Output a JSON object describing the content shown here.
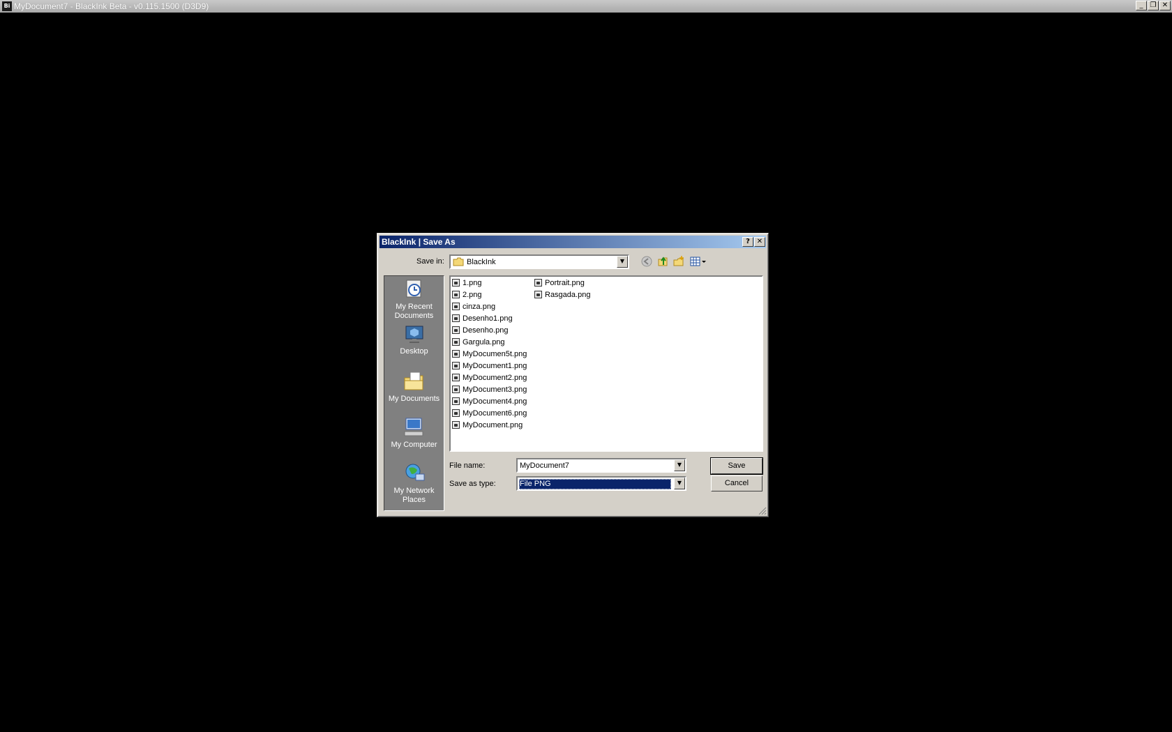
{
  "app": {
    "icon_text": "Bi",
    "title": "MyDocument7 - BlackInk Beta - v0.115.1500 (D3D9)",
    "minimize": "_",
    "restore": "❐",
    "close": "✕"
  },
  "dialog": {
    "title": "BlackInk | Save As",
    "help": "?",
    "close": "✕",
    "save_in_label": "Save in:",
    "save_in_value": "BlackInk",
    "places": [
      {
        "label": "My Recent Documents",
        "icon": "recent-documents-icon"
      },
      {
        "label": "Desktop",
        "icon": "desktop-icon"
      },
      {
        "label": "My Documents",
        "icon": "my-documents-icon"
      },
      {
        "label": "My Computer",
        "icon": "my-computer-icon"
      },
      {
        "label": "My Network Places",
        "icon": "network-places-icon"
      }
    ],
    "files_col1": [
      "1.png",
      "2.png",
      "cinza.png",
      "Desenho1.png",
      "Desenho.png",
      "Gargula.png",
      "MyDocumen5t.png",
      "MyDocument1.png",
      "MyDocument2.png",
      "MyDocument3.png",
      "MyDocument4.png",
      "MyDocument6.png",
      "MyDocument.png"
    ],
    "files_col2": [
      "Portrait.png",
      "Rasgada.png"
    ],
    "file_name_label": "File name:",
    "file_name_value": "MyDocument7",
    "save_type_label": "Save as type:",
    "save_type_value": "File PNG",
    "save_button": "Save",
    "cancel_button": "Cancel"
  }
}
